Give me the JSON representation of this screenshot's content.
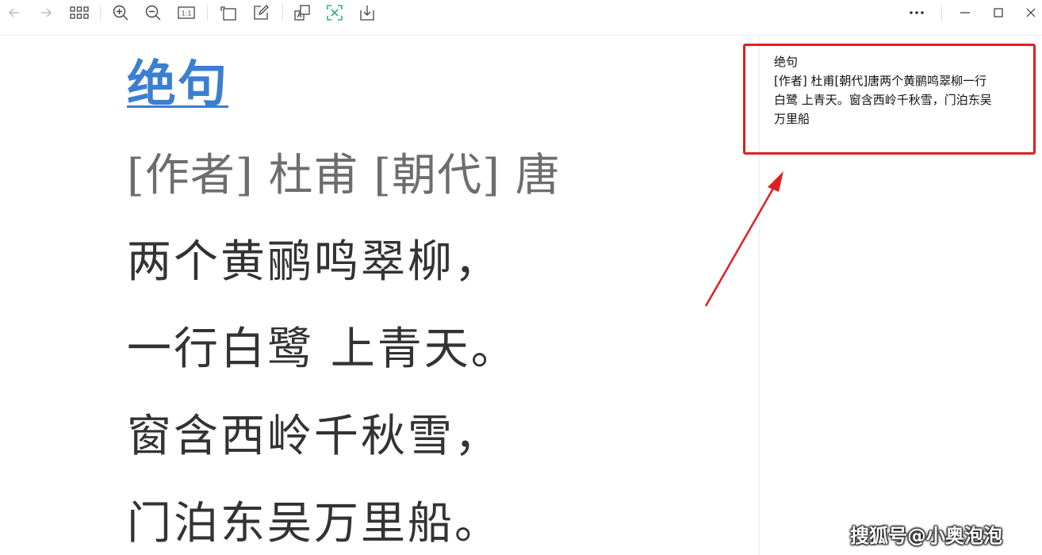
{
  "toolbar": {
    "buttons": [
      {
        "icon": "arrow-left-icon",
        "name": "back-button"
      },
      {
        "icon": "arrow-right-icon",
        "name": "forward-button"
      },
      {
        "icon": "grid-icon",
        "name": "thumbnails-button"
      },
      {
        "icon": "zoom-in-icon",
        "name": "zoom-in-button"
      },
      {
        "icon": "zoom-out-icon",
        "name": "zoom-out-button"
      },
      {
        "icon": "actual-size-icon",
        "name": "actual-size-button",
        "label": "1:1"
      },
      {
        "icon": "rotate-icon",
        "name": "rotate-button"
      },
      {
        "icon": "edit-icon",
        "name": "edit-button"
      },
      {
        "icon": "translate-icon",
        "name": "translate-button"
      },
      {
        "icon": "ocr-scan-icon",
        "name": "ocr-button",
        "color": "#2db37a"
      },
      {
        "icon": "download-icon",
        "name": "save-button"
      },
      {
        "icon": "more-icon",
        "name": "more-button"
      },
      {
        "icon": "minimize-icon",
        "name": "minimize-button"
      },
      {
        "icon": "maximize-icon",
        "name": "maximize-button"
      },
      {
        "icon": "close-icon",
        "name": "close-button"
      }
    ]
  },
  "document": {
    "title": "绝句",
    "author_line": "[作者] 杜甫 [朝代] 唐",
    "lines": [
      "两个黄鹂鸣翠柳，",
      "一行白鹭 上青天。",
      "窗含西岭千秋雪，",
      "门泊东吴万里船。"
    ]
  },
  "ocr_result": {
    "lines": [
      "绝句",
      "[作者] 杜甫[朝代]唐两个黄鹂鸣翠柳一行",
      "白鹭 上青天。窗含西岭千秋雪，门泊东吴",
      "万里船"
    ]
  },
  "watermark": "搜狐号@小奥泡泡",
  "colors": {
    "title": "#3b7fd1",
    "annotation": "#e02020",
    "ocr_icon": "#2db37a"
  }
}
